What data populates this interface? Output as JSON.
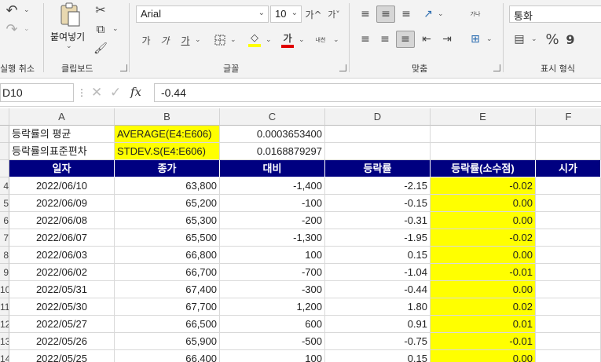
{
  "ribbon": {
    "undo_label": "실행 취소",
    "clipboard": {
      "paste_label": "붙여넣기",
      "group_label": "클립보드"
    },
    "font": {
      "name": "Arial",
      "size": "10",
      "grow_label": "가^",
      "shrink_label": "가˅",
      "bold_label": "가",
      "italic_label": "가",
      "underline_label": "가",
      "phonetic_label": "내천",
      "font_color_label": "가",
      "group_label": "글꼴"
    },
    "alignment": {
      "wrap_label": "가나",
      "group_label": "맞춤"
    },
    "number": {
      "format_value": "통화",
      "percent_label": "%",
      "comma_label": "9",
      "group_label": "표시 형식"
    }
  },
  "formula_bar": {
    "name_box": "D10",
    "fx_label": "fx",
    "value": "-0.44"
  },
  "columns": [
    "A",
    "B",
    "C",
    "D",
    "E",
    "F"
  ],
  "summary": [
    {
      "label": "등락률의 평균",
      "formula": "AVERAGE(E4:E606)",
      "value": "0.0003653400"
    },
    {
      "label": "등락률의표준편차",
      "formula": "STDEV.S(E4:E606)",
      "value": "0.0168879297"
    }
  ],
  "table_headers": [
    "일자",
    "종가",
    "대비",
    "등락률",
    "등락률(소수점)",
    "시가"
  ],
  "row_headers": [
    "",
    "",
    "",
    "4",
    "5",
    "6",
    "7",
    "8",
    "9",
    "10",
    "11",
    "12",
    "13",
    "14"
  ],
  "rows": [
    {
      "date": "2022/06/10",
      "close": "63,800",
      "change": "-1,400",
      "rate": "-2.15",
      "rate_dec": "-0.02"
    },
    {
      "date": "2022/06/09",
      "close": "65,200",
      "change": "-100",
      "rate": "-0.15",
      "rate_dec": "0.00"
    },
    {
      "date": "2022/06/08",
      "close": "65,300",
      "change": "-200",
      "rate": "-0.31",
      "rate_dec": "0.00"
    },
    {
      "date": "2022/06/07",
      "close": "65,500",
      "change": "-1,300",
      "rate": "-1.95",
      "rate_dec": "-0.02"
    },
    {
      "date": "2022/06/03",
      "close": "66,800",
      "change": "100",
      "rate": "0.15",
      "rate_dec": "0.00"
    },
    {
      "date": "2022/06/02",
      "close": "66,700",
      "change": "-700",
      "rate": "-1.04",
      "rate_dec": "-0.01"
    },
    {
      "date": "2022/05/31",
      "close": "67,400",
      "change": "-300",
      "rate": "-0.44",
      "rate_dec": "0.00"
    },
    {
      "date": "2022/05/30",
      "close": "67,700",
      "change": "1,200",
      "rate": "1.80",
      "rate_dec": "0.02"
    },
    {
      "date": "2022/05/27",
      "close": "66,500",
      "change": "600",
      "rate": "0.91",
      "rate_dec": "0.01"
    },
    {
      "date": "2022/05/26",
      "close": "65,900",
      "change": "-500",
      "rate": "-0.75",
      "rate_dec": "-0.01"
    },
    {
      "date": "2022/05/25",
      "close": "66,400",
      "change": "100",
      "rate": "0.15",
      "rate_dec": "0.00"
    }
  ]
}
